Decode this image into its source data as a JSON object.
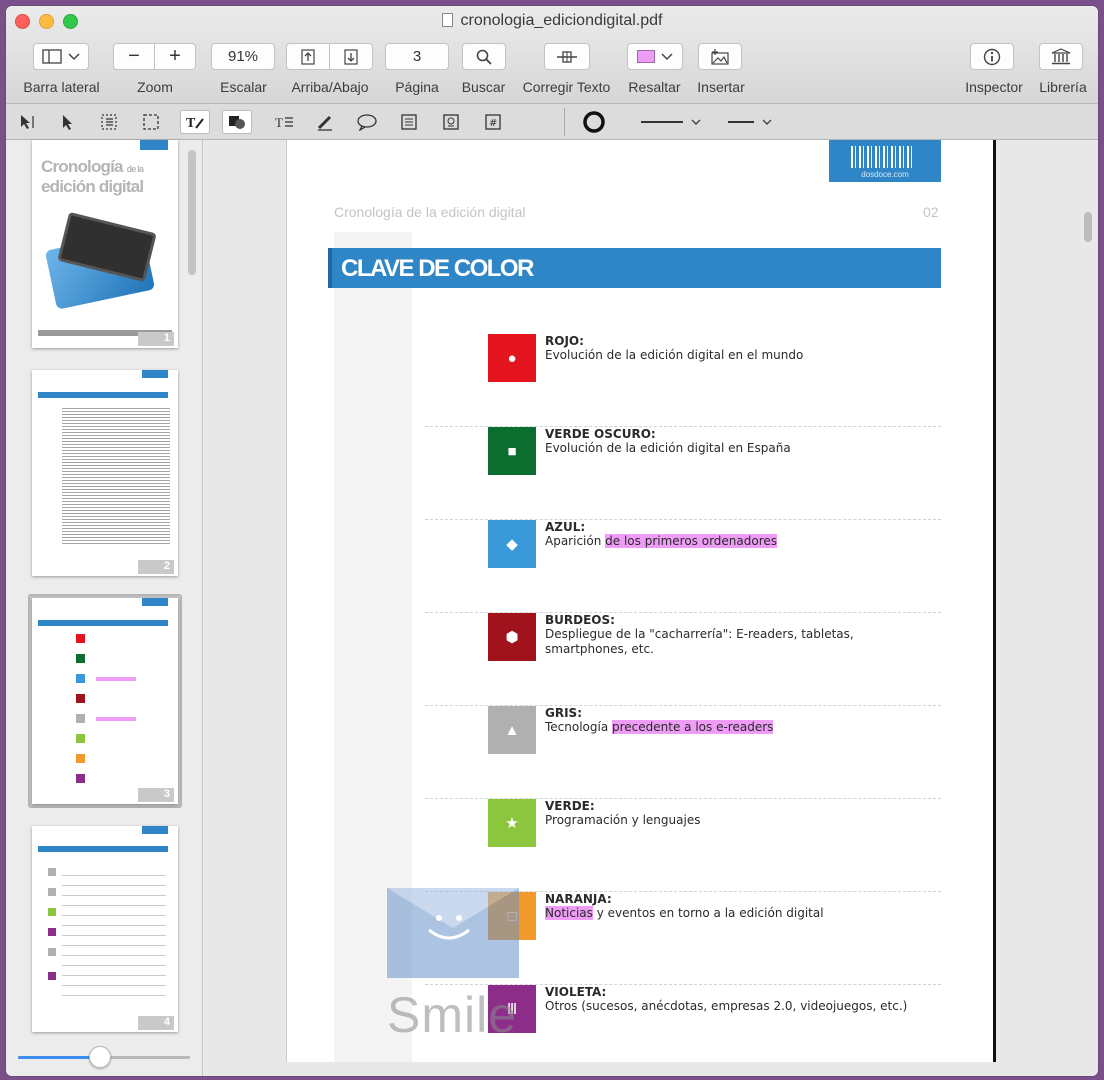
{
  "window": {
    "title": "cronologia_ediciondigital.pdf"
  },
  "toolbar": {
    "sidebar_label": "Barra lateral",
    "zoom_label": "Zoom",
    "zoom_out": "−",
    "zoom_in": "+",
    "scale_value": "91%",
    "scale_label": "Escalar",
    "updown_label": "Arriba/Abajo",
    "page_value": "3",
    "page_label": "Página",
    "search_label": "Buscar",
    "correct_label": "Corregir Texto",
    "highlight_label": "Resaltar",
    "insert_label": "Insertar",
    "inspector_label": "Inspector",
    "library_label": "Librería"
  },
  "annotations": {
    "line_style": "──",
    "arrow_style": "—"
  },
  "sidebar": {
    "thumbs": [
      {
        "num": "1",
        "title_a": "Cronología",
        "title_small": "de la",
        "title_b": "edición digital"
      },
      {
        "num": "2"
      },
      {
        "num": "3"
      },
      {
        "num": "4"
      }
    ],
    "slider_value": 0.45
  },
  "page": {
    "running_head": "Cronología de la edición digital",
    "page_number": "02",
    "barcode_text": "dosdoce.com",
    "banner": "CLAVE DE COLOR",
    "items": [
      {
        "name": "ROJO:",
        "desc": "Evolución de la edición digital en el mundo",
        "symbol": "●",
        "color": "#e4141e"
      },
      {
        "name": "VERDE OSCURO:",
        "desc": "Evolución de la edición digital en España",
        "symbol": "■",
        "color": "#0b6e2f"
      },
      {
        "name": "AZUL:",
        "desc_pre": "Aparición ",
        "desc_hl": "de los primeros ordenadores",
        "symbol": "◆",
        "color": "#3a9ad9"
      },
      {
        "name": "BURDEOS:",
        "desc": "Despliegue de la \"cacharrería\": E-readers, tabletas, smartphones, etc.",
        "symbol": "⬢",
        "color": "#a0131d"
      },
      {
        "name": "GRIS:",
        "desc_pre": "Tecnología ",
        "desc_hl": "precedente a los e-readers",
        "symbol": "▲",
        "color": "#b0b0b0"
      },
      {
        "name": "VERDE:",
        "desc": "Programación y lenguajes",
        "symbol": "★",
        "color": "#8cc63e"
      },
      {
        "name": "NARANJA:",
        "desc_hl": "Noticias",
        "desc_post": " y eventos en torno a la edición digital",
        "symbol": "□",
        "color": "#f39a2c"
      },
      {
        "name": "VIOLETA:",
        "desc": "Otros (sucesos, anécdotas, empresas 2.0, videojuegos, etc.)",
        "symbol": "Ⅲ",
        "color": "#8d2d8a"
      }
    ],
    "watermark": "Smile"
  },
  "colors": {
    "accent_blue": "#2f86c6",
    "highlight": "#ee9cf5",
    "slider_blue": "#3d8ef0"
  }
}
